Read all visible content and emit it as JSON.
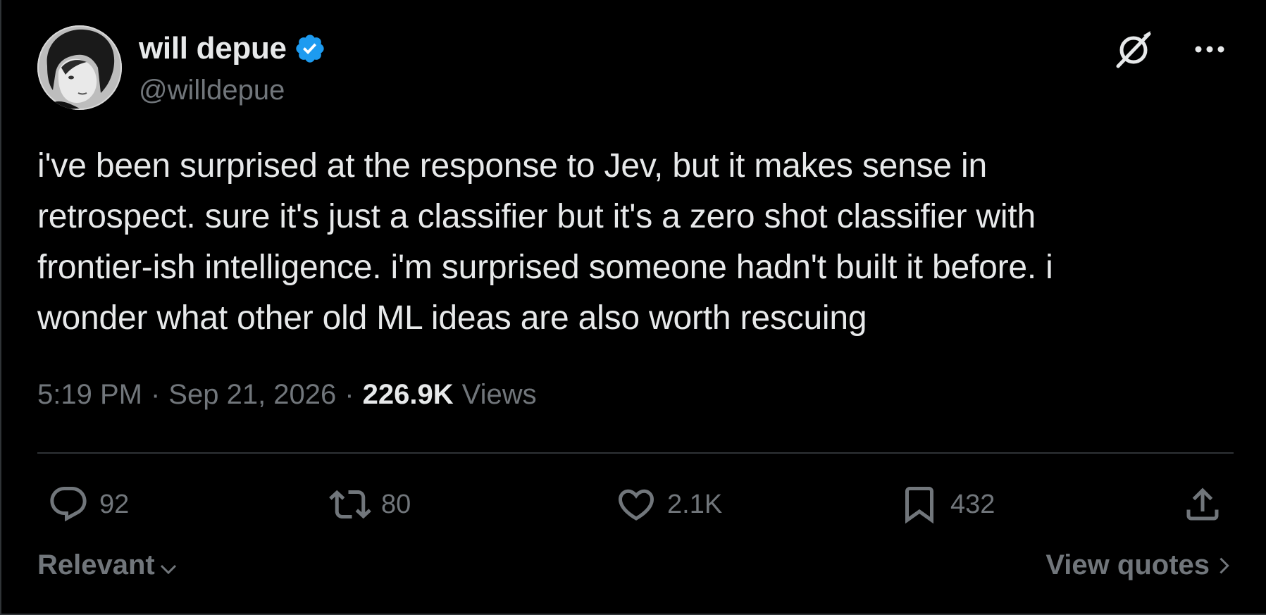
{
  "author": {
    "display_name": "will depue",
    "handle": "@willdepue",
    "verified": true,
    "verified_color": "#1d9bf0"
  },
  "header_icons": [
    "grok-icon",
    "more-options-icon"
  ],
  "tweet": {
    "text": "i've been surprised at the response to Jev, but it makes sense in\nretrospect. sure it's just a classifier but it's a zero shot classifier with\nfrontier-ish intelligence. i'm surprised someone hadn't built it before. i\nwonder what other old ML ideas are also worth rescuing",
    "time": "5:19 PM",
    "separator": "·",
    "date": "Sep 21, 2026",
    "views_count": "226.9K",
    "views_label": "Views"
  },
  "actions": {
    "replies": "92",
    "reposts": "80",
    "likes": "2.1K",
    "bookmarks": "432"
  },
  "footer": {
    "sort_label": "Relevant",
    "quotes_label": "View quotes"
  },
  "colors": {
    "background": "#000000",
    "text_primary": "#e7e9ea",
    "text_secondary": "#71767b",
    "divider": "#2f3336"
  }
}
